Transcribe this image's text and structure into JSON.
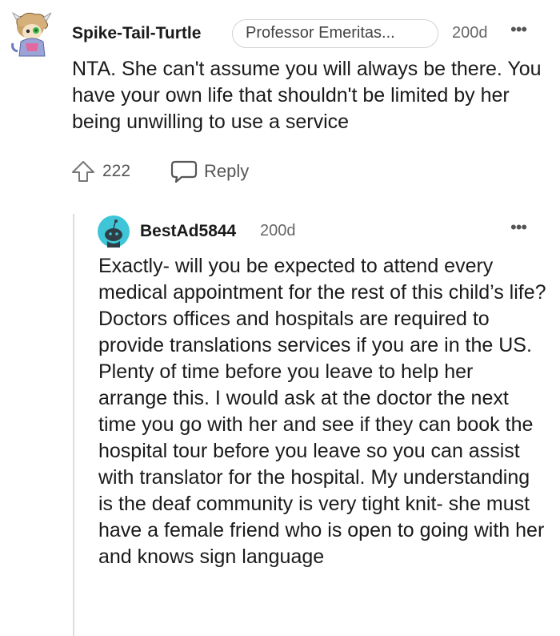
{
  "top_comment": {
    "avatar": "turtle-character-avatar",
    "username": "Spike-Tail-Turtle",
    "flair": "Professor Emeritas...",
    "age": "200d",
    "more": "•••",
    "body": "NTA. She can't assume you will always be there. You have your own life that shouldn't be limited by her being unwilling to use a service",
    "upvote_icon": "upvote-arrow-icon",
    "votes": "222",
    "reply_icon": "speech-bubble-icon",
    "reply_label": "Reply"
  },
  "reply_comment": {
    "avatar": "snoo-avatar",
    "username": "BestAd5844",
    "age": "200d",
    "more": "•••",
    "body": "Exactly- will you be expected to attend every medical appointment for the rest of this child’s life? Doctors offices and hospitals are required to provide translations services if you are in the US. Plenty of time before you leave to help her arrange this. I would ask at the doctor the next time you go with her and see if they can book the hospital tour before you leave so you can assist with translator for the hospital. My understanding is the deaf community is very tight knit- she must have a female friend who is open to going with her and knows sign language"
  },
  "colors": {
    "text": "#1a1a1b",
    "meta": "#666666",
    "thread_line": "#dadcde",
    "snoo_teal": "#3ec6d8"
  }
}
